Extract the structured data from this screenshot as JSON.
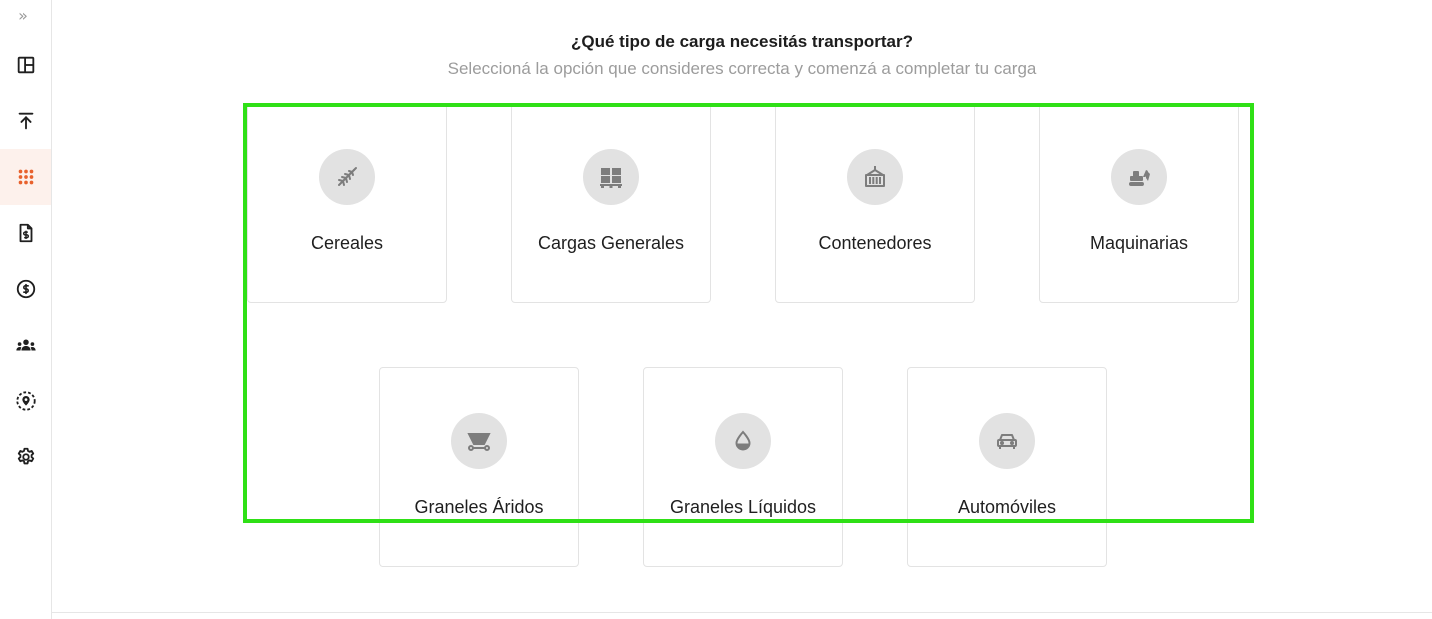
{
  "sidebar": {
    "expand_glyph": "»",
    "items": [
      {
        "name": "dashboard",
        "icon": "layout-icon",
        "active": false
      },
      {
        "name": "upload",
        "icon": "upload-icon",
        "active": false
      },
      {
        "name": "grid",
        "icon": "grid-dots-icon",
        "active": true
      },
      {
        "name": "invoice",
        "icon": "document-dollar-icon",
        "active": false
      },
      {
        "name": "payments",
        "icon": "dollar-circle-icon",
        "active": false
      },
      {
        "name": "users",
        "icon": "users-icon",
        "active": false
      },
      {
        "name": "locations",
        "icon": "location-pin-icon",
        "active": false
      },
      {
        "name": "settings",
        "icon": "gear-icon",
        "active": false
      }
    ]
  },
  "header": {
    "title": "¿Qué tipo de carga necesitás transportar?",
    "subtitle": "Seleccioná la opción que consideres correcta y comenzá a completar tu carga"
  },
  "cards": [
    {
      "label": "Cereales",
      "icon": "wheat-icon"
    },
    {
      "label": "Cargas Generales",
      "icon": "pallet-boxes-icon"
    },
    {
      "label": "Contenedores",
      "icon": "container-icon"
    },
    {
      "label": "Maquinarias",
      "icon": "machinery-icon"
    },
    {
      "label": "Graneles Áridos",
      "icon": "hopper-wagon-icon"
    },
    {
      "label": "Graneles Líquidos",
      "icon": "drop-icon"
    },
    {
      "label": "Automóviles",
      "icon": "car-icon"
    }
  ],
  "colors": {
    "accent": "#e8612c",
    "active_bg": "#fdf1ec",
    "highlight": "#2fe016",
    "icon_gray": "#7d7d7d",
    "circle_bg": "#e2e2e2"
  }
}
